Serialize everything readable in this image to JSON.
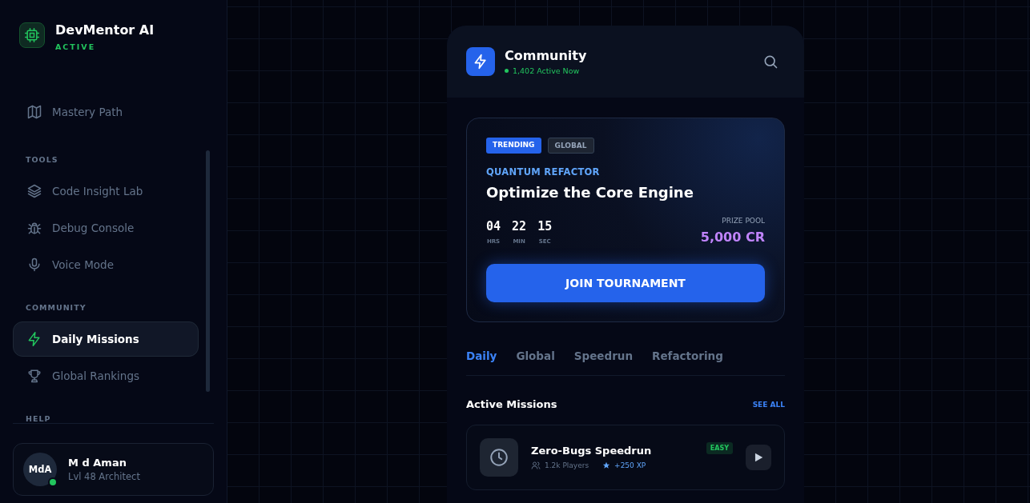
{
  "brand": {
    "name": "DevMentor AI",
    "status": "ACTIVE"
  },
  "sidebar": {
    "items": [
      {
        "kind": "link",
        "label": "Mastery Path",
        "selected": false
      },
      {
        "kind": "section",
        "label": "TOOLS"
      },
      {
        "kind": "link",
        "label": "Code Insight Lab",
        "selected": false
      },
      {
        "kind": "link",
        "label": "Debug Console",
        "selected": false
      },
      {
        "kind": "link",
        "label": "Voice Mode",
        "selected": false
      },
      {
        "kind": "section",
        "label": "COMMUNITY"
      },
      {
        "kind": "link",
        "label": "Daily Missions",
        "selected": true
      },
      {
        "kind": "link",
        "label": "Global Rankings",
        "selected": false
      },
      {
        "kind": "section",
        "label": "HELP"
      }
    ]
  },
  "user": {
    "initials": "MdA",
    "name": "M d Aman",
    "role": "Lvl 48 Architect",
    "online": true
  },
  "header": {
    "title": "Community",
    "active": "1,402 Active Now"
  },
  "tournament": {
    "tags": [
      {
        "label": "TRENDING",
        "kind": "primary"
      },
      {
        "label": "GLOBAL",
        "kind": "muted"
      }
    ],
    "category": "QUANTUM REFACTOR",
    "title": "Optimize the Core Engine",
    "timer": [
      {
        "value": "04",
        "unit": "HRS"
      },
      {
        "value": "22",
        "unit": "MIN"
      },
      {
        "value": "15",
        "unit": "SEC"
      }
    ],
    "prize_label": "PRIZE POOL",
    "prize": "5,000 CR",
    "button": "JOIN TOURNAMENT"
  },
  "tabs": [
    {
      "label": "Daily",
      "selected": true
    },
    {
      "label": "Global",
      "selected": false
    },
    {
      "label": "Speedrun",
      "selected": false
    },
    {
      "label": "Refactoring",
      "selected": false
    }
  ],
  "missions": {
    "title": "Active Missions",
    "see_all": "SEE ALL",
    "items": [
      {
        "title": "Zero-Bugs Speedrun",
        "players": "1.2k Players",
        "xp": "+250 XP",
        "difficulty": "EASY"
      }
    ]
  }
}
